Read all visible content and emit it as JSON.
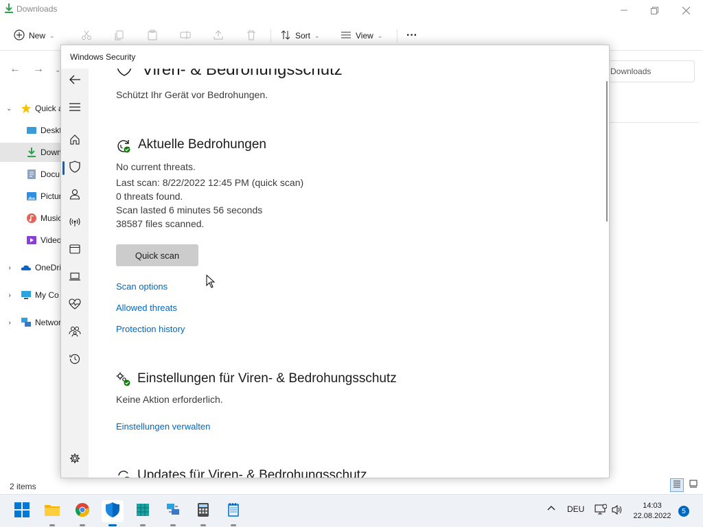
{
  "explorer": {
    "title": "Downloads",
    "toolbar": {
      "new_label": "New",
      "sort_label": "Sort",
      "view_label": "View",
      "more_label": "···"
    },
    "address_text": "Downloads",
    "sidebar": [
      {
        "label": "Quick a",
        "icon": "star-icon"
      },
      {
        "label": "Deskt",
        "icon": "desktop-folder-icon"
      },
      {
        "label": "Down",
        "icon": "download-folder-icon"
      },
      {
        "label": "Docu",
        "icon": "documents-folder-icon"
      },
      {
        "label": "Pictur",
        "icon": "pictures-folder-icon"
      },
      {
        "label": "Music",
        "icon": "music-folder-icon"
      },
      {
        "label": "Video",
        "icon": "videos-folder-icon"
      },
      {
        "label": "OneDri",
        "icon": "onedrive-icon"
      },
      {
        "label": "My Co",
        "icon": "computer-icon"
      },
      {
        "label": "Networ",
        "icon": "network-icon"
      }
    ],
    "status_text": "2 items"
  },
  "security": {
    "window_title": "Windows Security",
    "page_title": "Viren- & Bedrohungsschutz",
    "subtitle": "Schützt Ihr Gerät vor Bedrohungen.",
    "current_threats": {
      "heading": "Aktuelle Bedrohungen",
      "status": "No current threats.",
      "last_scan": "Last scan: 8/22/2022 12:45 PM (quick scan)",
      "threats_found": "0 threats found.",
      "duration": "Scan lasted 6 minutes 56 seconds",
      "files_scanned": "38587 files scanned.",
      "quick_scan_label": "Quick scan",
      "links": [
        "Scan options",
        "Allowed threats",
        "Protection history"
      ]
    },
    "settings": {
      "heading": "Einstellungen für Viren- & Bedrohungsschutz",
      "status": "Keine Aktion erforderlich.",
      "manage_link": "Einstellungen verwalten"
    },
    "updates": {
      "heading": "Updates für Viren- & Bedrohungsschutz"
    },
    "accent_color": "#0067c0"
  },
  "taskbar": {
    "language": "DEU",
    "time": "14:03",
    "date": "22.08.2022",
    "notification_count": "5"
  }
}
